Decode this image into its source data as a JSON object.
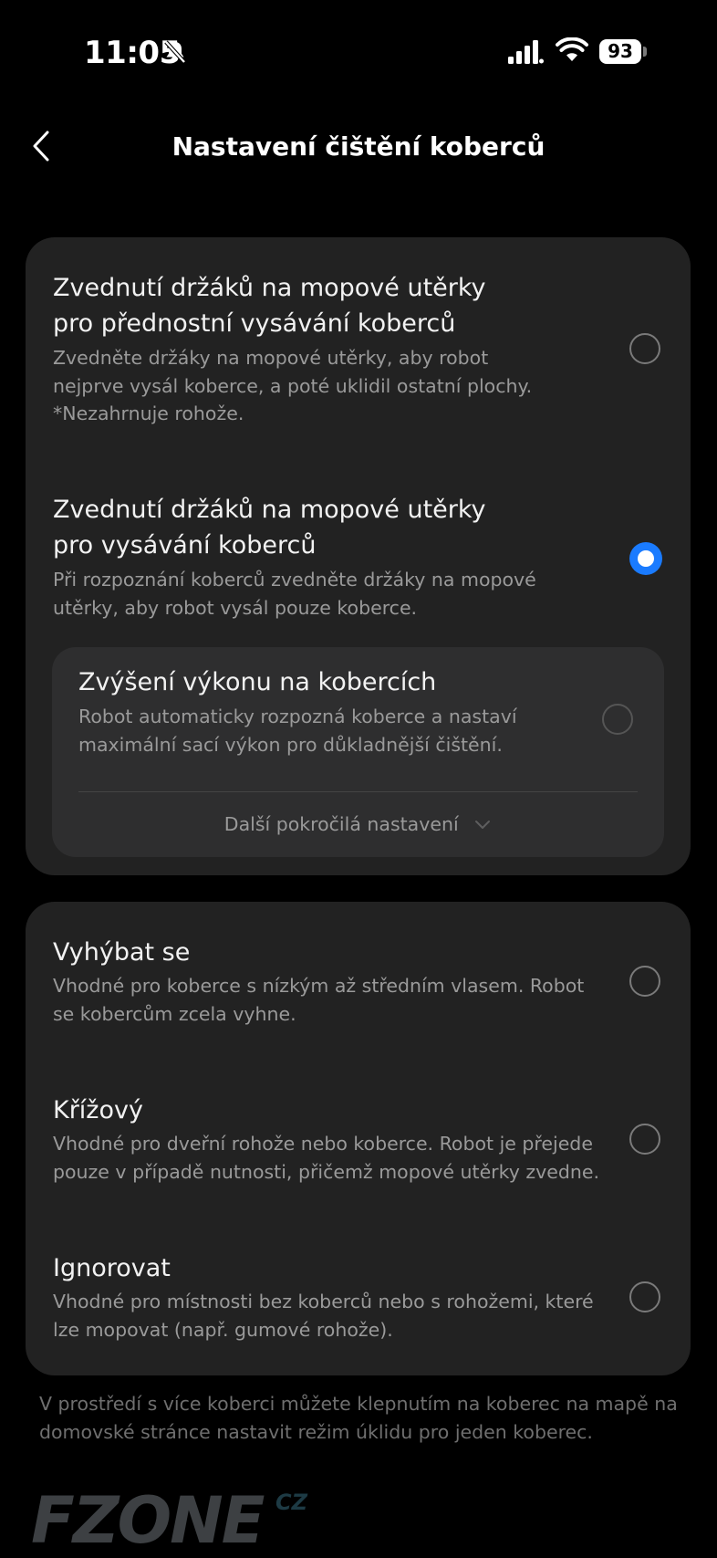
{
  "status_bar": {
    "time": "11:05",
    "battery": "93",
    "icons": [
      "bell-slash-icon",
      "signal-icon",
      "wifi-icon",
      "battery-icon"
    ]
  },
  "header": {
    "title": "Nastavení čištění koberců",
    "back_icon": "chevron-left-icon"
  },
  "card1": {
    "options": [
      {
        "title": "Zvednutí držáků na mopové utěrky pro přednostní vysávání koberců",
        "desc": "Zvedněte držáky na mopové utěrky, aby robot nejprve vysál koberce, a poté uklidil ostatní plochy. *Nezahrnuje rohože.",
        "selected": false
      },
      {
        "title": "Zvednutí držáků na mopové utěrky pro vysávání koberců",
        "desc": "Při rozpoznání koberců zvedněte držáky na mopové utěrky, aby robot vysál pouze koberce.",
        "selected": true
      }
    ],
    "sub": {
      "title": "Zvýšení výkonu na kobercích",
      "desc": "Robot automaticky rozpozná koberce a nastaví maximální sací výkon pro důkladnější čištění.",
      "selected": false,
      "more_label": "Další pokročilá nastavení"
    }
  },
  "card2": {
    "options": [
      {
        "title": "Vyhýbat se",
        "desc": "Vhodné pro koberce s nízkým až středním vlasem. Robot se kobercům zcela vyhne.",
        "selected": false
      },
      {
        "title": "Křížový",
        "desc": "Vhodné pro dveřní rohože nebo koberce. Robot je přejede pouze v případě nutnosti, přičemž mopové utěrky zvedne.",
        "selected": false
      },
      {
        "title": "Ignorovat",
        "desc": "Vhodné pro místnosti bez koberců nebo s rohožemi, které lze mopovat (např. gumové rohože).",
        "selected": false
      }
    ]
  },
  "footer_note": "V prostředí s více koberci můžete klepnutím na koberec na mapě na domovské stránce nastavit režim úklidu pro jeden koberec.",
  "watermark": {
    "text": "FZONE",
    "suffix": "CZ"
  },
  "colors": {
    "background": "#000000",
    "card": "#222222",
    "subcard": "#2e2e2f",
    "accent": "#1a7bff",
    "text_primary": "#f2f2f2",
    "text_secondary": "#9a9a9a"
  }
}
